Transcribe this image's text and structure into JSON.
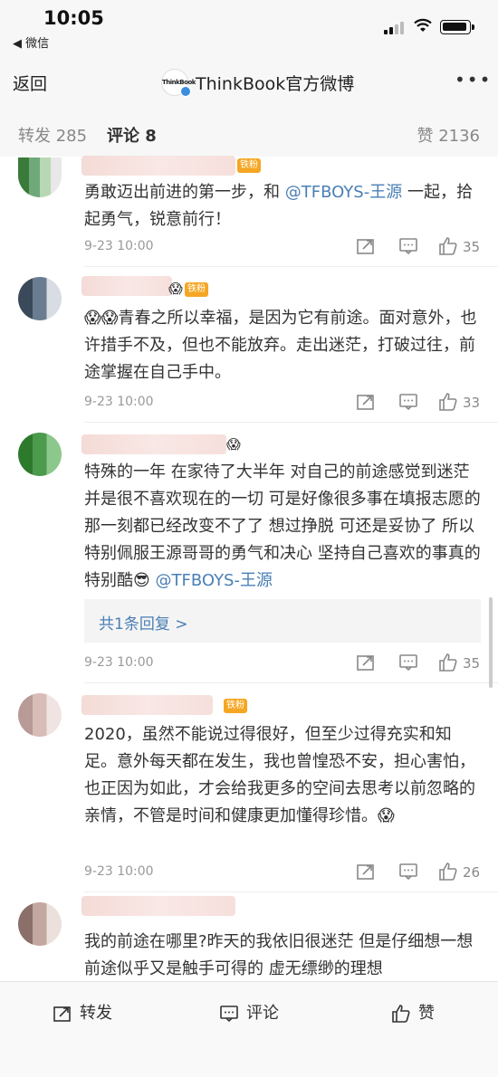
{
  "status": {
    "time": "10:05",
    "back_app": "◀ 微信"
  },
  "nav": {
    "back": "返回",
    "logo_text": "ThinkBook",
    "title": "ThinkBook官方微博",
    "more": "•••"
  },
  "tabs": {
    "repost": "转发 285",
    "comment": "评论 8",
    "like": "赞 2136"
  },
  "comments": [
    {
      "badge": "铁粉",
      "text_before": "勇敢迈出前进的第一步，和 ",
      "mention": "@TFBOYS-王源",
      "text_after": " 一起，拾起勇气，锐意前行！",
      "time": "9-23 10:00",
      "likes": "35"
    },
    {
      "badge": "铁粉",
      "text": "青春之所以幸福，是因为它有前途。面对意外，也许措手不及，但也不能放弃。走出迷茫，打破过往，前途掌握在自己手中。",
      "time": "9-23 10:00",
      "likes": "33"
    },
    {
      "text_before": "特殊的一年 在家待了大半年 对自己的前途感觉到迷茫 并是很不喜欢现在的一切 可是好像很多事在填报志愿的那一刻都已经改变不了了 想过挣脱 可还是妥协了 所以特别佩服王源哥哥的勇气和决心 坚持自己喜欢的事真的特别酷",
      "mention": "@TFBOYS-王源",
      "reply_link": "共1条回复 >",
      "time": "9-23 10:00",
      "likes": "35"
    },
    {
      "badge": "铁粉",
      "text": "2020，虽然不能说过得很好，但至少过得充实和知足。意外每天都在发生，我也曾惶恐不安，担心害怕，也正因为如此，才会给我更多的空间去思考以前忽略的亲情，不管是时间和健康更加懂得珍惜。",
      "time": "9-23 10:00",
      "likes": "26"
    },
    {
      "text": "我的前途在哪里?昨天的我依旧很迷茫 但是仔细想一想 前途似乎又是触手可得的 虚无缥缈的理想"
    }
  ],
  "bottom": {
    "repost": "转发",
    "comment": "评论",
    "like": "赞"
  }
}
